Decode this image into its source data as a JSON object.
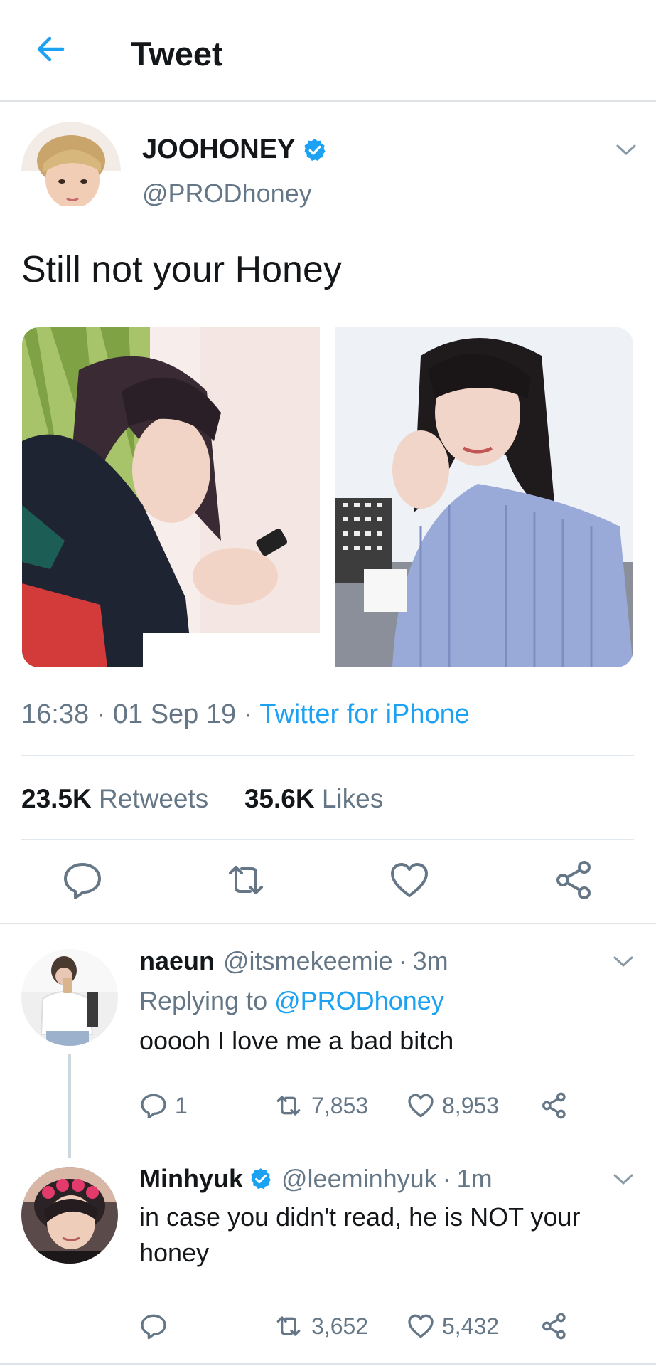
{
  "header": {
    "title": "Tweet",
    "back_icon": "arrow-left-icon"
  },
  "colors": {
    "accent": "#1da1f2",
    "muted": "#657786",
    "text": "#14171a",
    "divider": "#e1e8ed"
  },
  "tweet": {
    "author_name": "JOOHONEY",
    "author_handle": "@PRODhoney",
    "verified": true,
    "text": "Still not your Honey",
    "time": "16:38",
    "date": "01 Sep 19",
    "source": "Twitter for iPhone",
    "retweets_count": "23.5K",
    "retweets_label": "Retweets",
    "likes_count": "35.6K",
    "likes_label": "Likes",
    "media_count": 2
  },
  "replies": [
    {
      "name": "naeun",
      "handle": "@itsmekeemie",
      "age": "3m",
      "replying_prefix": "Replying to",
      "replying_to": "@PRODhoney",
      "text": "ooooh I love me a bad bitch",
      "reply_count": "1",
      "retweet_count": "7,853",
      "like_count": "8,953"
    },
    {
      "name": "Minhyuk",
      "verified": true,
      "handle": "@leeminhyuk",
      "age": "1m",
      "text": "in case you didn't read, he is NOT your honey",
      "reply_count": "",
      "retweet_count": "3,652",
      "like_count": "5,432"
    }
  ]
}
